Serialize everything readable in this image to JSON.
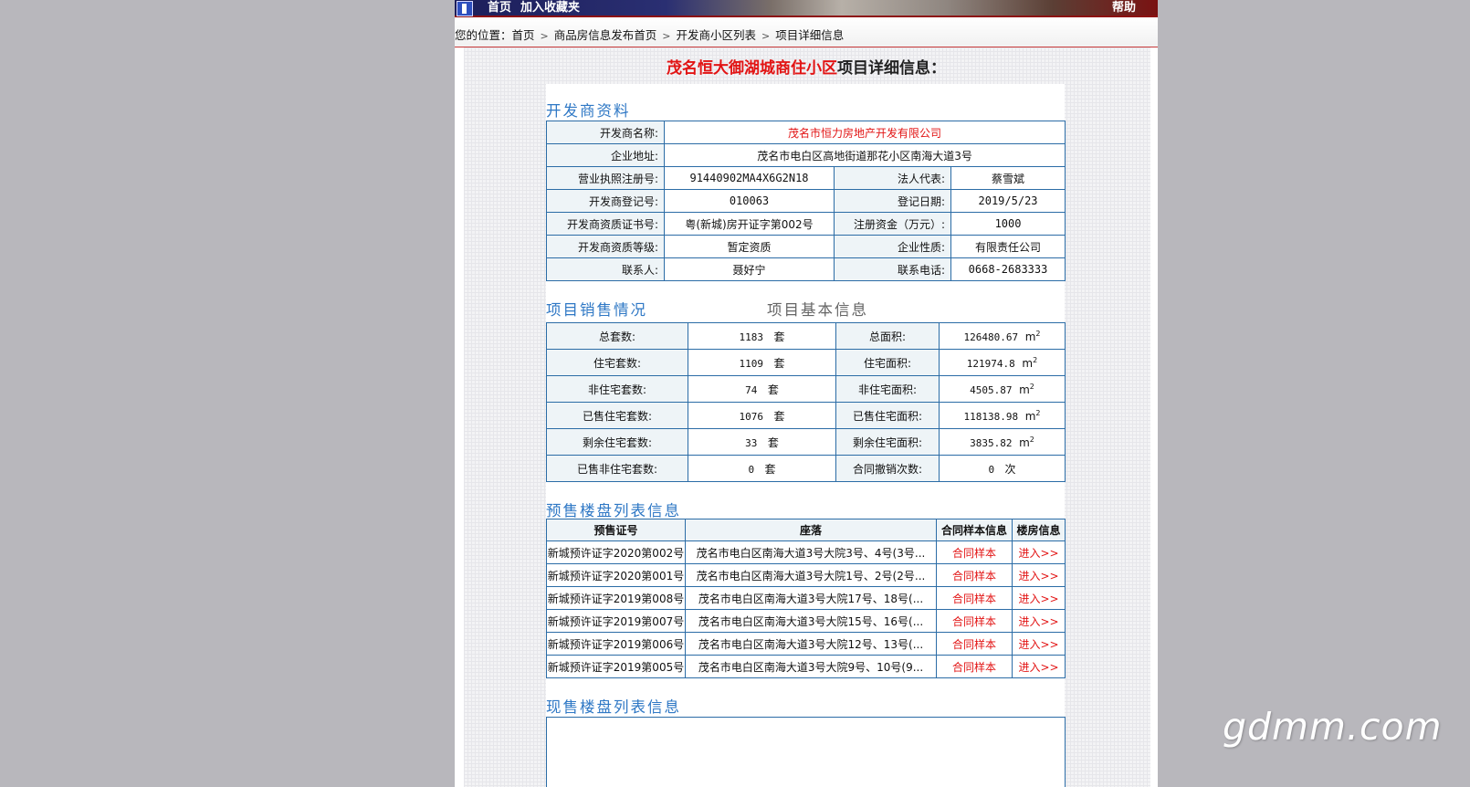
{
  "topbar": {
    "home": "首页",
    "favorite": "加入收藏夹",
    "help": "帮助"
  },
  "breadcrumb": {
    "prefix": "您的位置：",
    "items": [
      "首页",
      "商品房信息发布首页",
      "开发商小区列表",
      "项目详细信息"
    ]
  },
  "page_title": {
    "project": "茂名恒大御湖城商住小区",
    "suffix": "项目详细信息："
  },
  "developer": {
    "section": "开发商资料",
    "name_label": "开发商名称:",
    "name": "茂名市恒力房地产开发有限公司",
    "address_label": "企业地址:",
    "address": "茂名市电白区高地街道那花小区南海大道3号",
    "license_label": "营业执照注册号:",
    "license": "91440902MA4X6G2N18",
    "legal_label": "法人代表:",
    "legal": "蔡雪斌",
    "regno_label": "开发商登记号:",
    "regno": "010063",
    "regdate_label": "登记日期:",
    "regdate": "2019/5/23",
    "cert_label": "开发商资质证书号:",
    "cert": "粤(新城)房开证字第002号",
    "capital_label": "注册资金（万元）:",
    "capital": "1000",
    "grade_label": "开发商资质等级:",
    "grade": "暂定资质",
    "nature_label": "企业性质:",
    "nature": "有限责任公司",
    "contact_label": "联系人:",
    "contact": "聂好宁",
    "phone_label": "联系电话:",
    "phone": "0668-2683333"
  },
  "sales": {
    "section": "项目销售情况",
    "section2": "项目基本信息",
    "unit_set": "套",
    "unit_area": "m",
    "unit_times": "次",
    "rows": [
      {
        "l1": "总套数:",
        "v1": "1183",
        "l2": "总面积:",
        "v2": "126480.67",
        "u2": "area"
      },
      {
        "l1": "住宅套数:",
        "v1": "1109",
        "l2": "住宅面积:",
        "v2": "121974.8",
        "u2": "area"
      },
      {
        "l1": "非住宅套数:",
        "v1": "74",
        "l2": "非住宅面积:",
        "v2": "4505.87",
        "u2": "area"
      },
      {
        "l1": "已售住宅套数:",
        "v1": "1076",
        "l2": "已售住宅面积:",
        "v2": "118138.98",
        "u2": "area"
      },
      {
        "l1": "剩余住宅套数:",
        "v1": "33",
        "l2": "剩余住宅面积:",
        "v2": "3835.82",
        "u2": "area"
      },
      {
        "l1": "已售非住宅套数:",
        "v1": "0",
        "l2": "合同撤销次数:",
        "v2": "0",
        "u2": "times"
      }
    ]
  },
  "presale": {
    "section": "预售楼盘列表信息",
    "headers": [
      "预售证号",
      "座落",
      "合同样本信息",
      "楼房信息"
    ],
    "contract_link": "合同样本",
    "enter_link": "进入>>",
    "rows": [
      {
        "cert": "新城预许证字2020第002号",
        "location": "茂名市电白区南海大道3号大院3号、4号(3号..."
      },
      {
        "cert": "新城预许证字2020第001号",
        "location": "茂名市电白区南海大道3号大院1号、2号(2号..."
      },
      {
        "cert": "新城预许证字2019第008号",
        "location": "茂名市电白区南海大道3号大院17号、18号(..."
      },
      {
        "cert": "新城预许证字2019第007号",
        "location": "茂名市电白区南海大道3号大院15号、16号(..."
      },
      {
        "cert": "新城预许证字2019第006号",
        "location": "茂名市电白区南海大道3号大院12号、13号(..."
      },
      {
        "cert": "新城预许证字2019第005号",
        "location": "茂名市电白区南海大道3号大院9号、10号(9..."
      }
    ]
  },
  "current": {
    "section": "现售楼盘列表信息"
  },
  "watermark": "gdmm.com"
}
